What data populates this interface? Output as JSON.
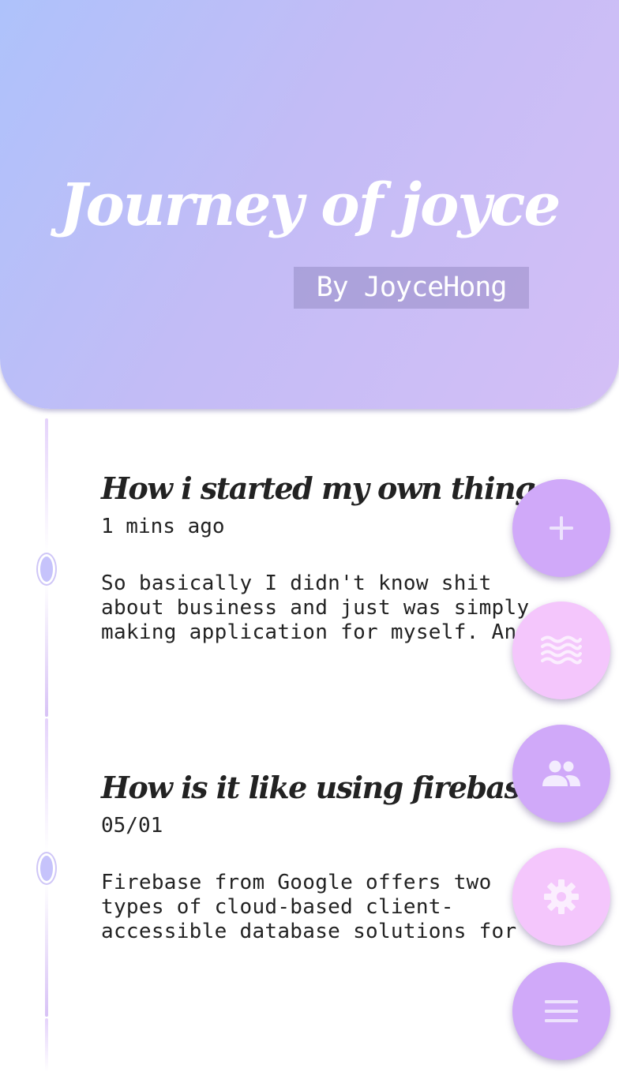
{
  "header": {
    "title": "Journey of joyce",
    "byline": "By JoyceHong"
  },
  "posts": [
    {
      "title": "How i started my own thing",
      "time": "1 mins ago",
      "excerpt": "So basically I didn't know shit about business and just was simply making application for myself. And one day"
    },
    {
      "title": "How is it like using firebase?",
      "time": "05/01",
      "excerpt": "Firebase from Google offers two types of cloud-based client-accessible database solutions for mobile apps that"
    }
  ],
  "fabs": [
    {
      "icon": "plus-icon",
      "color": "#d0a9f9"
    },
    {
      "icon": "waves-icon",
      "color": "#f4c6fc"
    },
    {
      "icon": "people-icon",
      "color": "#d0a9f9"
    },
    {
      "icon": "gear-icon",
      "color": "#f4c6fc"
    },
    {
      "icon": "menu-icon",
      "color": "#d0a9f9"
    }
  ],
  "colors": {
    "header_gradient_start": "#aec2fb",
    "header_gradient_end": "#d4bff6",
    "fab_purple": "#d0a9f9",
    "fab_pink": "#f4c6fc",
    "text": "#222222"
  }
}
